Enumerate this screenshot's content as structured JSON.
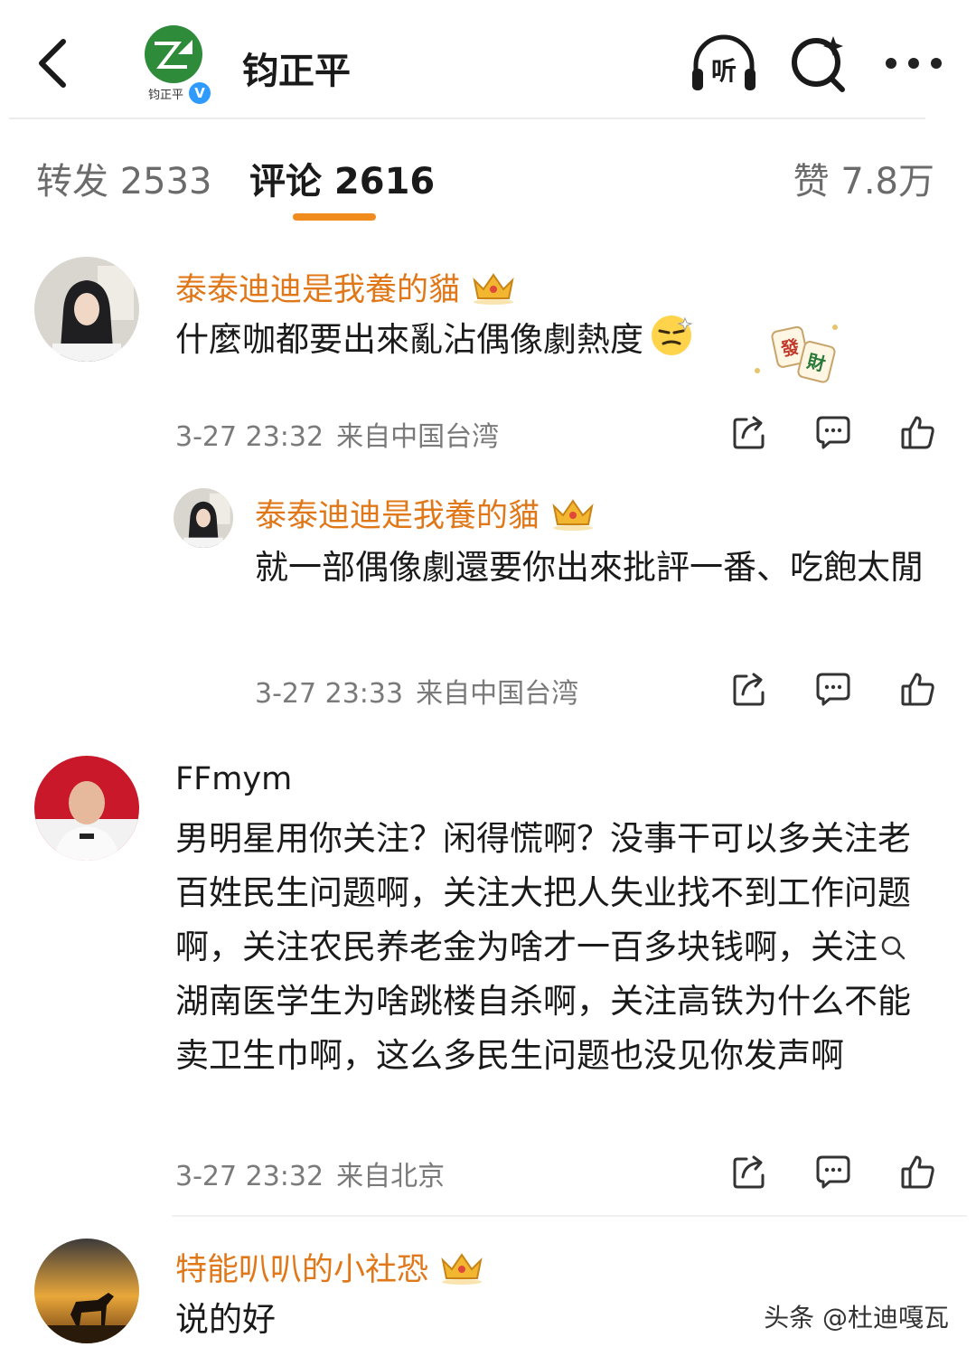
{
  "header": {
    "title": "钧正平",
    "logo_text": "钧正平",
    "verified_mark": "V",
    "listen_label": "听"
  },
  "tabs": {
    "repost": "转发 2533",
    "comments": "评论 2616",
    "likes": "赞 7.8万"
  },
  "comments": [
    {
      "username": "泰泰迪迪是我養的貓",
      "text": "什麼咖都要出來亂沾偶像劇熱度",
      "sticker_text": [
        "發",
        "財"
      ],
      "time": "3-27 23:32",
      "location": "来自中国台湾"
    },
    {
      "username": "泰泰迪迪是我養的貓",
      "text": "就一部偶像劇還要你出來批評一番、吃飽太閒",
      "time": "3-27 23:33",
      "location": "来自中国台湾"
    },
    {
      "username": "FFmym",
      "text": "男明星用你关注？闲得慌啊？没事干可以多关注老百姓民生问题啊，关注大把人失业找不到工作问题啊，关注农民养老金为啥才一百多块钱啊，关注",
      "search_topic": "湖南医学生为啥跳楼自杀啊",
      "text_tail": "，关注高铁为什么不能卖卫生巾啊，这么多民生问题也没见你发声啊",
      "time": "3-27 23:32",
      "location": "来自北京"
    },
    {
      "username": "特能叭叭的小社恐",
      "text": "说的好"
    }
  ],
  "watermark": "头条 @杜迪嘎瓦",
  "colors": {
    "vip_name": "#e0781a",
    "tab_indicator": "#f08b1e",
    "meta_text": "#7a7a7a",
    "verified": "#2f9bff"
  },
  "icons": {
    "back": "chevron-left-icon",
    "listen": "headphones-icon",
    "search": "search-sparkle-icon",
    "more": "more-dots-icon",
    "share": "share-icon",
    "comment": "comment-bubble-icon",
    "like": "thumbs-up-icon",
    "vip": "crown-icon"
  }
}
